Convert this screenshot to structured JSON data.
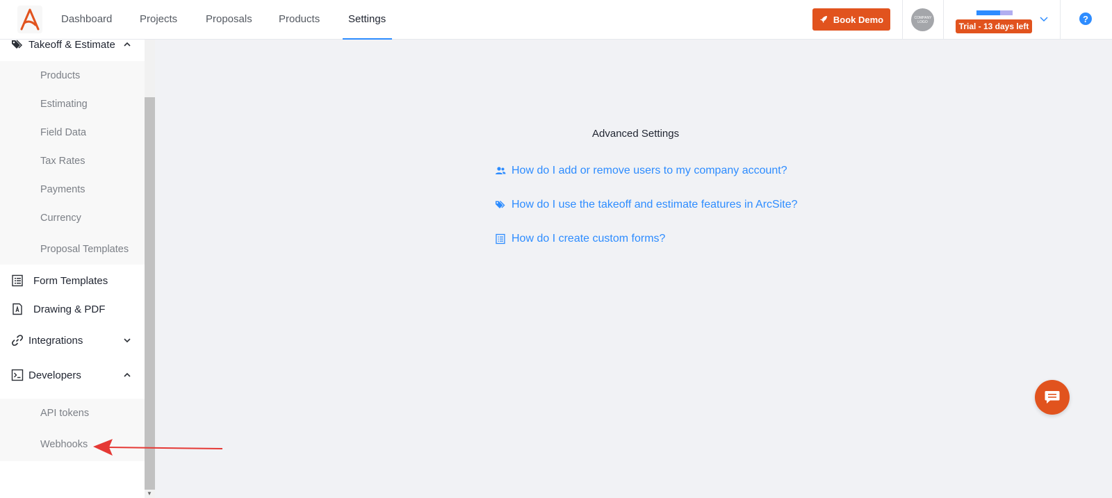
{
  "nav": {
    "items": [
      "Dashboard",
      "Projects",
      "Proposals",
      "Products",
      "Settings"
    ],
    "active": "Settings",
    "book_demo": "Book Demo",
    "company_logo": "COMPANY LOGO",
    "trial_label": "Trial - 13 days left",
    "trial_progress_fraction": 0.65,
    "help": "?"
  },
  "sidebar": {
    "takeoff": {
      "label": "Takeoff & Estimate",
      "items": [
        "Products",
        "Estimating",
        "Field Data",
        "Tax Rates",
        "Payments",
        "Currency",
        "Proposal Templates"
      ]
    },
    "form_templates": "Form Templates",
    "drawing_pdf": "Drawing & PDF",
    "integrations": "Integrations",
    "developers": {
      "label": "Developers",
      "items": [
        "API tokens",
        "Webhooks"
      ]
    }
  },
  "main": {
    "title": "Advanced Settings",
    "links": [
      "How do I add or remove users to my company account?",
      "How do I use the takeoff and estimate features in ArcSite?",
      "How do I create custom forms?"
    ]
  },
  "colors": {
    "accent": "#2d8cff",
    "brand": "#e1531e",
    "annotation_arrow": "#e53935"
  },
  "icons": [
    "arcsite-logo-icon",
    "rocket-icon",
    "chevron-down-icon",
    "help-icon",
    "tags-icon",
    "chevron-up-icon",
    "form-list-icon",
    "pdf-file-icon",
    "link-icon",
    "terminal-icon",
    "users-icon",
    "chat-icon"
  ]
}
